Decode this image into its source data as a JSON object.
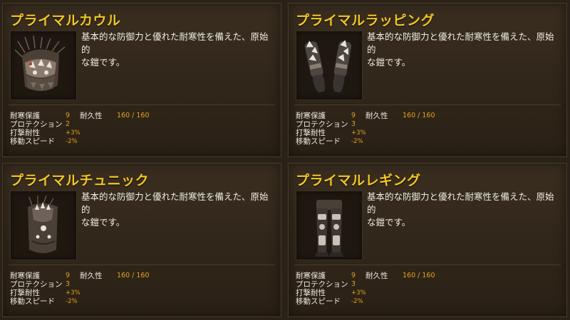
{
  "common": {
    "description_line1": "基本的な防御力と優れた耐寒性を備えた、原始的",
    "description_line2": "な鎧です。",
    "durability_label": "耐久性",
    "durability_value": "160 / 160",
    "stat_labels": [
      "耐寒保護",
      "プロテクション",
      "打撃耐性",
      "移動スピード"
    ]
  },
  "items": [
    {
      "name": "プライマルカウル",
      "icon": "primal-cowl-icon",
      "stats": [
        "9",
        "2",
        "+3%",
        "-2%"
      ]
    },
    {
      "name": "プライマルラッピング",
      "icon": "primal-wrapping-icon",
      "stats": [
        "9",
        "3",
        "+3%",
        "-2%"
      ]
    },
    {
      "name": "プライマルチュニック",
      "icon": "primal-tunic-icon",
      "stats": [
        "9",
        "3",
        "+3%",
        "-2%"
      ]
    },
    {
      "name": "プライマルレギング",
      "icon": "primal-leggings-icon",
      "stats": [
        "9",
        "3",
        "+3%",
        "-2%"
      ]
    }
  ],
  "colors": {
    "title": "#f2c626",
    "value": "#e0a11e",
    "background": "#2a2218"
  }
}
